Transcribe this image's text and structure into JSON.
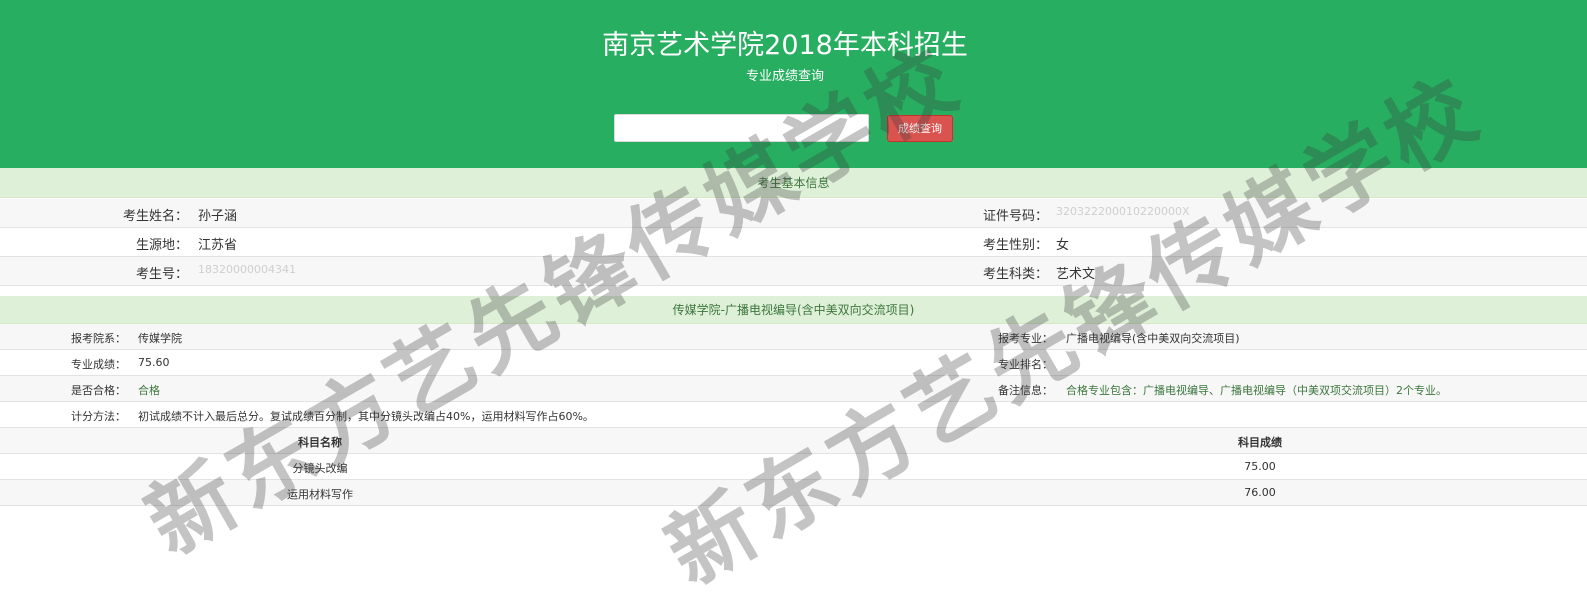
{
  "header": {
    "title": "南京艺术学院2018年本科招生",
    "subtitle": "专业成绩查询",
    "search_value": "",
    "query_button_label": "成绩查询"
  },
  "basic_info": {
    "section_title": "考生基本信息",
    "name_label": "考生姓名：",
    "name_value": "孙子涵",
    "id_label": "证件号码：",
    "id_value": "320322200010220000X",
    "origin_label": "生源地：",
    "origin_value": "江苏省",
    "gender_label": "考生性别：",
    "gender_value": "女",
    "exam_no_label": "考生号：",
    "exam_no_value": "18320000004341",
    "category_label": "考生科类：",
    "category_value": "艺术文"
  },
  "major_section": {
    "section_title": "传媒学院-广播电视编导(含中美双向交流项目)",
    "dept_label": "报考院系：",
    "dept_value": "传媒学院",
    "major_label": "报考专业：",
    "major_value": "广播电视编导(含中美双向交流项目)",
    "score_label": "专业成绩：",
    "score_value": "75.60",
    "rank_label": "专业排名：",
    "rank_value": "",
    "pass_label": "是否合格：",
    "pass_value": "合格",
    "note_label": "备注信息：",
    "note_value": "合格专业包含：广播电视编导、广播电视编导（中美双项交流项目）2个专业。",
    "method_label": "计分方法：",
    "method_value": "初试成绩不计入最后总分。复试成绩百分制，其中分镜头改编占40%，运用材料写作占60%。"
  },
  "subject_table": {
    "headers": [
      "科目名称",
      "科目成绩"
    ],
    "rows": [
      {
        "subject": "分镜头改编",
        "score": "75.00"
      },
      {
        "subject": "运用材料写作",
        "score": "76.00"
      }
    ]
  },
  "watermark": {
    "text": "新东方艺先锋传媒学校"
  },
  "colors": {
    "header_bg": "#27ae60",
    "section_bg": "#dff0d8",
    "section_text": "#3c763d",
    "button_bg": "#d9534f"
  }
}
